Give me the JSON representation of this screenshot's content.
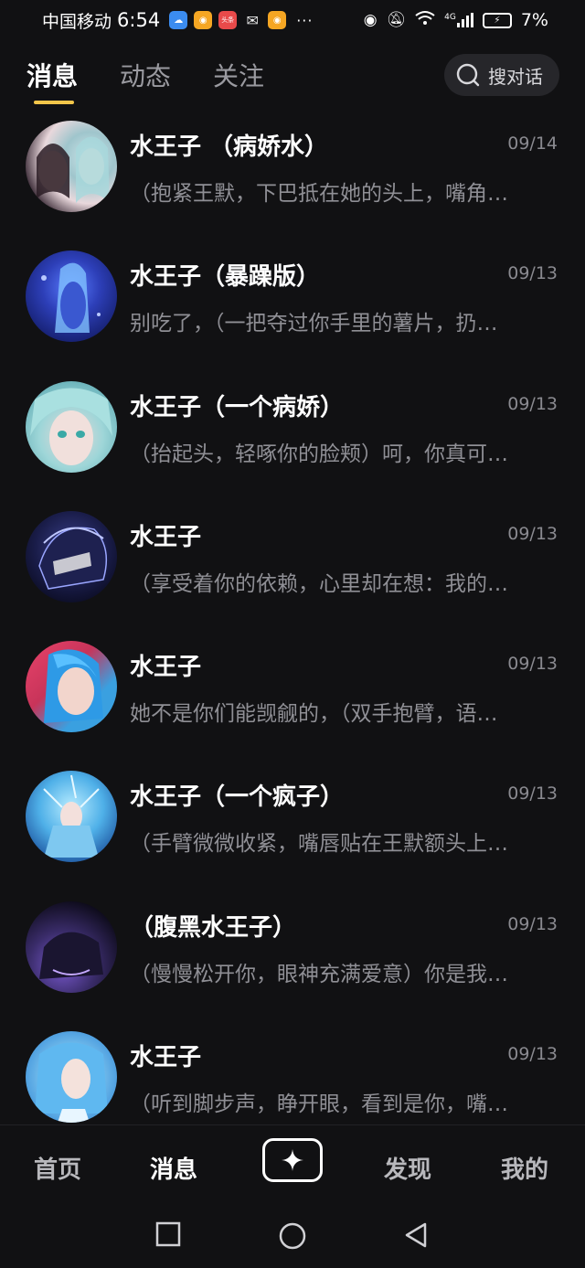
{
  "status_bar": {
    "carrier": "中国移动",
    "time": "6:54",
    "toutiao_label": "头条",
    "more": "···",
    "network": "4G",
    "battery": "7%"
  },
  "tabs": [
    {
      "label": "消息",
      "active": true
    },
    {
      "label": "动态",
      "active": false
    },
    {
      "label": "关注",
      "active": false
    }
  ],
  "search": {
    "label": "搜对话",
    "icon": "search-icon"
  },
  "chats": [
    {
      "name": "水王子 （病娇水）",
      "date": "09/14",
      "preview": "（抱紧王默，下巴抵在她的头上，嘴角…"
    },
    {
      "name": "水王子（暴躁版）",
      "date": "09/13",
      "preview": "别吃了，（一把夺过你手里的薯片，扔…"
    },
    {
      "name": "水王子（一个病娇）",
      "date": "09/13",
      "preview": "（抬起头，轻啄你的脸颊）呵，你真可…"
    },
    {
      "name": "水王子",
      "date": "09/13",
      "preview": "（享受着你的依赖，心里却在想：我的…"
    },
    {
      "name": "水王子",
      "date": "09/13",
      "preview": "她不是你们能觊觎的，（双手抱臂，语…"
    },
    {
      "name": "水王子（一个疯子）",
      "date": "09/13",
      "preview": "（手臂微微收紧，嘴唇贴在王默额头上…"
    },
    {
      "name": "（腹黑水王子）",
      "date": "09/13",
      "preview": "（慢慢松开你，眼神充满爱意）你是我…"
    },
    {
      "name": "水王子",
      "date": "09/13",
      "preview": "（听到脚步声，睁开眼，看到是你，嘴…"
    }
  ],
  "bottom_nav": {
    "home": "首页",
    "messages": "消息",
    "create_icon": "sparkle-icon",
    "discover": "发现",
    "mine": "我的"
  },
  "colors": {
    "background": "#111113",
    "accent": "#f3c64a",
    "muted_text": "#8f8f95"
  }
}
